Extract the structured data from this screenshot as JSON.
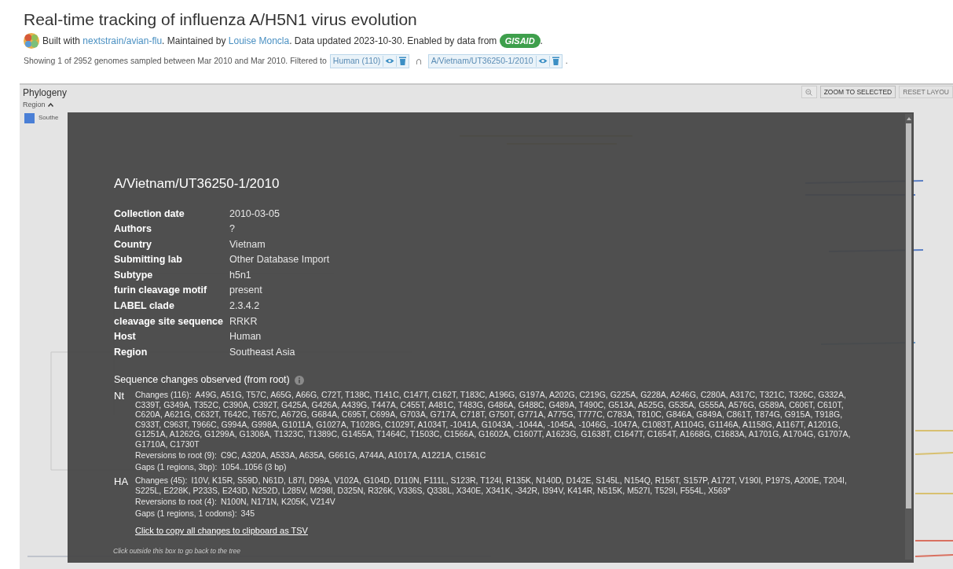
{
  "header": {
    "title": "Real-time tracking of influenza A/H5N1 virus evolution",
    "byline": [
      {
        "kind": "text",
        "text": "Built with "
      },
      {
        "kind": "link",
        "text": "nextstrain/avian-flu"
      },
      {
        "kind": "text",
        "text": ". Maintained by "
      },
      {
        "kind": "link",
        "text": "Louise Moncla"
      },
      {
        "kind": "text",
        "text": ". Data updated 2023-10-30. Enabled by data from "
      },
      {
        "kind": "badge",
        "text": "GISAID"
      },
      {
        "kind": "text",
        "text": "."
      }
    ],
    "summary": "Showing 1 of 2952 genomes sampled between Mar 2010 and Mar 2010. Filtered to",
    "filters": [
      {
        "label": "Human (110)"
      },
      {
        "label": "A/Vietnam/UT36250-1/2010"
      }
    ],
    "filter_join": "∩",
    "summary_end": "."
  },
  "panel": {
    "title": "Phylogeny",
    "toolbar": [
      {
        "kind": "icon"
      },
      {
        "kind": "text",
        "label": "ZOOM TO SELECTED",
        "disabled": false
      },
      {
        "kind": "text",
        "label": "RESET LAYOU",
        "disabled": true
      }
    ],
    "legend": {
      "title": "Region",
      "expanded": true,
      "items": [
        {
          "label": "Southe",
          "color": "#4a7fd6"
        }
      ]
    }
  },
  "modal": {
    "strain": "A/Vietnam/UT36250-1/2010",
    "metadata": [
      {
        "label": "Collection date",
        "value": "2010-03-05"
      },
      {
        "label": "Authors",
        "value": "?"
      },
      {
        "label": "Country",
        "value": "Vietnam"
      },
      {
        "label": "Submitting lab",
        "value": "Other Database Import"
      },
      {
        "label": "Subtype",
        "value": "h5n1"
      },
      {
        "label": "furin cleavage motif",
        "value": "present"
      },
      {
        "label": "LABEL clade",
        "value": "2.3.4.2"
      },
      {
        "label": "cleavage site sequence",
        "value": "RRKR"
      },
      {
        "label": "Host",
        "value": "Human"
      },
      {
        "label": "Region",
        "value": "Southeast Asia"
      }
    ],
    "sequence_title": "Sequence changes observed (from root)",
    "genes": [
      {
        "name": "Nt",
        "rows": [
          {
            "label": "Changes (116):",
            "value": "A49G, A51G, T57C, A65G, A66G, C72T, T138C, T141C, C147T, C162T, T183C, A196G, G197A, A202G, C219G, G225A, G228A, A246G, C280A, A317C, T321C, T326C, G332A, C339T, G349A, T352C, C390A, C392T, G425A, G426A, A439G, T447A, C455T, A481C, T483G, G486A, G488C, G489A, T490C, G513A, A525G, G535A, G555A, A576G, G589A, C606T, C610T, C620A, A621G, C632T, T642C, T657C, A672G, G684A, C695T, C699A, G703A, G717A, C718T, G750T, G771A, A775G, T777C, C783A, T810C, G846A, G849A, C861T, T874G, G915A, T918G, C933T, C963T, T966C, G994A, G998A, G1011A, G1027A, T1028G, C1029T, A1034T, -1041A, G1043A, -1044A, -1045A, -1046G, -1047A, C1083T, A1104G, G1146A, A1158G, A1167T, A1201G, G1251A, A1262G, G1299A, G1308A, T1323C, T1389C, G1455A, T1464C, T1503C, C1566A, G1602A, C1607T, A1623G, G1638T, C1647T, C1654T, A1668G, C1683A, A1701G, A1704G, G1707A, G1710A, C1730T"
          },
          {
            "label": "Reversions to root (9):",
            "value": "C9C, A320A, A533A, A635A, G661G, A744A, A1017A, A1221A, C1561C"
          },
          {
            "label": "Gaps (1 regions, 3bp):",
            "value": "1054..1056 (3 bp)"
          }
        ]
      },
      {
        "name": "HA",
        "rows": [
          {
            "label": "Changes (45):",
            "value": "I10V, K15R, S59D, N61D, L87I, D99A, V102A, G104D, D110N, F111L, S123R, T124I, R135K, N140D, D142E, S145L, N154Q, R156T, S157P, A172T, V190I, P197S, A200E, T204I, S225L, E228K, P233S, E243D, N252D, L285V, M298I, D325N, R326K, V336S, Q338L, X340E, X341K, -342R, I394V, K414R, N515K, M527I, T529I, F554L, X569*"
          },
          {
            "label": "Reversions to root (4):",
            "value": "N100N, N171N, K205K, V214V"
          },
          {
            "label": "Gaps (1 regions, 1 codons):",
            "value": "345"
          }
        ]
      }
    ],
    "copy_link": "Click to copy all changes to clipboard as TSV",
    "hint": "Click outside this box to go back to the tree"
  }
}
